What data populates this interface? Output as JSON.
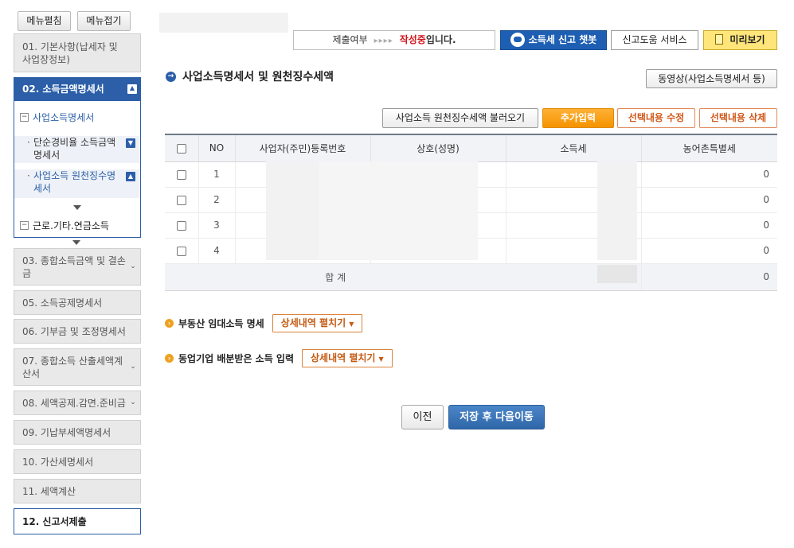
{
  "sidebar": {
    "expand_label": "메뉴펼침",
    "collapse_label": "메뉴접기",
    "items": [
      {
        "label": "01. 기본사항(납세자 및 사업장정보)"
      },
      {
        "label": "02. 소득금액명세서"
      },
      {
        "label": "03. 종합소득금액 및 결손금"
      },
      {
        "label": "05. 소득공제명세서"
      },
      {
        "label": "06. 기부금 및 조정명세서"
      },
      {
        "label": "07. 종합소득 산출세액계산서"
      },
      {
        "label": "08. 세액공제.감면.준비금"
      },
      {
        "label": "09. 기납부세액명세서"
      },
      {
        "label": "10. 가산세명세서"
      },
      {
        "label": "11. 세액계산"
      },
      {
        "label": "12. 신고서제출"
      }
    ],
    "subtree": {
      "group1_label": "사업소득명세서",
      "sub_items": [
        {
          "label": "단순경비율 소득금액명세서"
        },
        {
          "label": "사업소득 원천징수명세서"
        }
      ],
      "group2_label": "근로.기타.연금소득"
    }
  },
  "topbar": {
    "status_label": "제출여부",
    "status_arrows": "▸▸▸▸",
    "status_writing": "작성중",
    "status_suffix": "입니다.",
    "chatbot_label": "소득세 신고 챗봇",
    "help_label": "신고도움 서비스",
    "preview_label": "미리보기"
  },
  "section": {
    "title": "사업소득명세서 및 원천징수세액",
    "video_label": "동영상(사업소득명세서 등)"
  },
  "actions": {
    "load_label": "사업소득 원천징수세액 불러오기",
    "add_label": "추가입력",
    "edit_label": "선택내용 수정",
    "delete_label": "선택내용 삭제"
  },
  "table": {
    "headers": [
      "NO",
      "사업자(주민)등록번호",
      "상호(성명)",
      "소득세",
      "농어촌특별세"
    ],
    "rows": [
      {
        "no": "1",
        "rural_tax": "0"
      },
      {
        "no": "2",
        "rural_tax": "0"
      },
      {
        "no": "3",
        "rural_tax": "0"
      },
      {
        "no": "4",
        "rural_tax": "0"
      }
    ],
    "total_label": "합 계",
    "total_rural_tax": "0"
  },
  "folds": [
    {
      "label": "부동산 임대소득 명세",
      "button": "상세내역 펼치기"
    },
    {
      "label": "동업기업 배분받은 소득 입력",
      "button": "상세내역 펼치기"
    }
  ],
  "nav": {
    "prev_label": "이전",
    "next_label": "저장 후 다음이동"
  }
}
